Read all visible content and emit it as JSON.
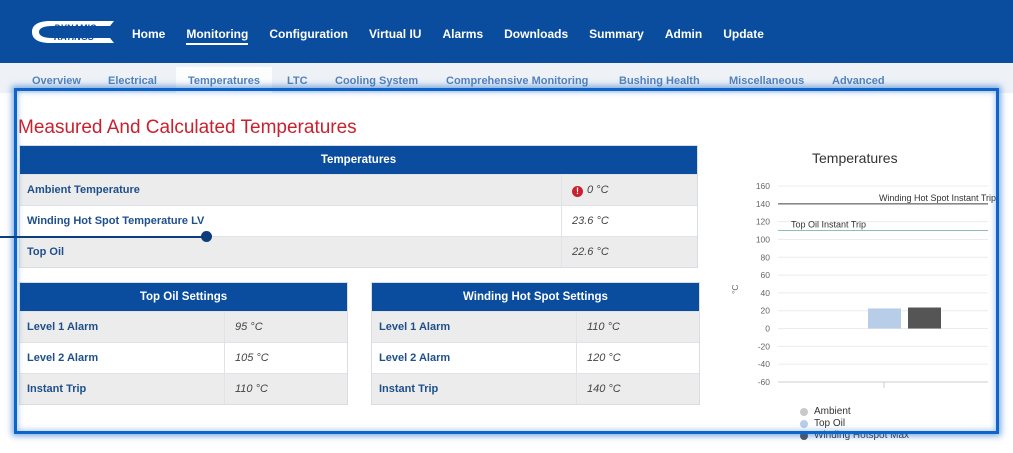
{
  "logo": {
    "line1": "DYNAMIC",
    "line2": "RATINGS"
  },
  "nav": {
    "items": [
      "Home",
      "Monitoring",
      "Configuration",
      "Virtual IU",
      "Alarms",
      "Downloads",
      "Summary",
      "Admin",
      "Update"
    ],
    "active": "Monitoring"
  },
  "subtabs": {
    "items": [
      "Overview",
      "Electrical",
      "Temperatures",
      "LTC",
      "Cooling System",
      "Comprehensive Monitoring",
      "Bushing Health",
      "Miscellaneous",
      "Advanced"
    ],
    "active": "Temperatures"
  },
  "page_title": "Measured And Calculated Temperatures",
  "temperatures_table": {
    "header": "Temperatures",
    "rows": [
      {
        "label": "Ambient Temperature",
        "value": "0 °C",
        "warning": true
      },
      {
        "label": "Winding Hot Spot Temperature LV",
        "value": "23.6 °C",
        "warning": false
      },
      {
        "label": "Top Oil",
        "value": "22.6 °C",
        "warning": false
      }
    ]
  },
  "top_oil_settings": {
    "header": "Top Oil Settings",
    "rows": [
      {
        "label": "Level 1 Alarm",
        "value": "95 °C"
      },
      {
        "label": "Level 2 Alarm",
        "value": "105 °C"
      },
      {
        "label": "Instant Trip",
        "value": "110 °C"
      }
    ]
  },
  "winding_settings": {
    "header": "Winding Hot Spot Settings",
    "rows": [
      {
        "label": "Level 1 Alarm",
        "value": "110 °C"
      },
      {
        "label": "Level 2 Alarm",
        "value": "120 °C"
      },
      {
        "label": "Instant Trip",
        "value": "140 °C"
      }
    ]
  },
  "colors": {
    "nav_bg": "#0a4d9f",
    "title_red": "#c8222e",
    "highlight": "#0e64c8"
  },
  "chart_data": {
    "type": "bar",
    "title": "Temperatures",
    "ylabel": "°C",
    "ylim": [
      -60,
      160
    ],
    "yticks": [
      -60,
      -40,
      -20,
      0,
      20,
      40,
      60,
      80,
      100,
      120,
      140,
      160
    ],
    "series": [
      {
        "name": "Ambient",
        "value": 0,
        "color": "#c9c9c9"
      },
      {
        "name": "Top Oil",
        "value": 22.6,
        "color": "#b7cde8"
      },
      {
        "name": "Winding Hotspot Max",
        "value": 23.6,
        "color": "#555555"
      }
    ],
    "plot_lines": [
      {
        "label": "Winding Hot Spot Instant Trip",
        "value": 140,
        "color": "#444444"
      },
      {
        "label": "Top Oil Instant Trip",
        "value": 110,
        "color": "#8fbfb3"
      }
    ],
    "legend_position": "bottom"
  }
}
